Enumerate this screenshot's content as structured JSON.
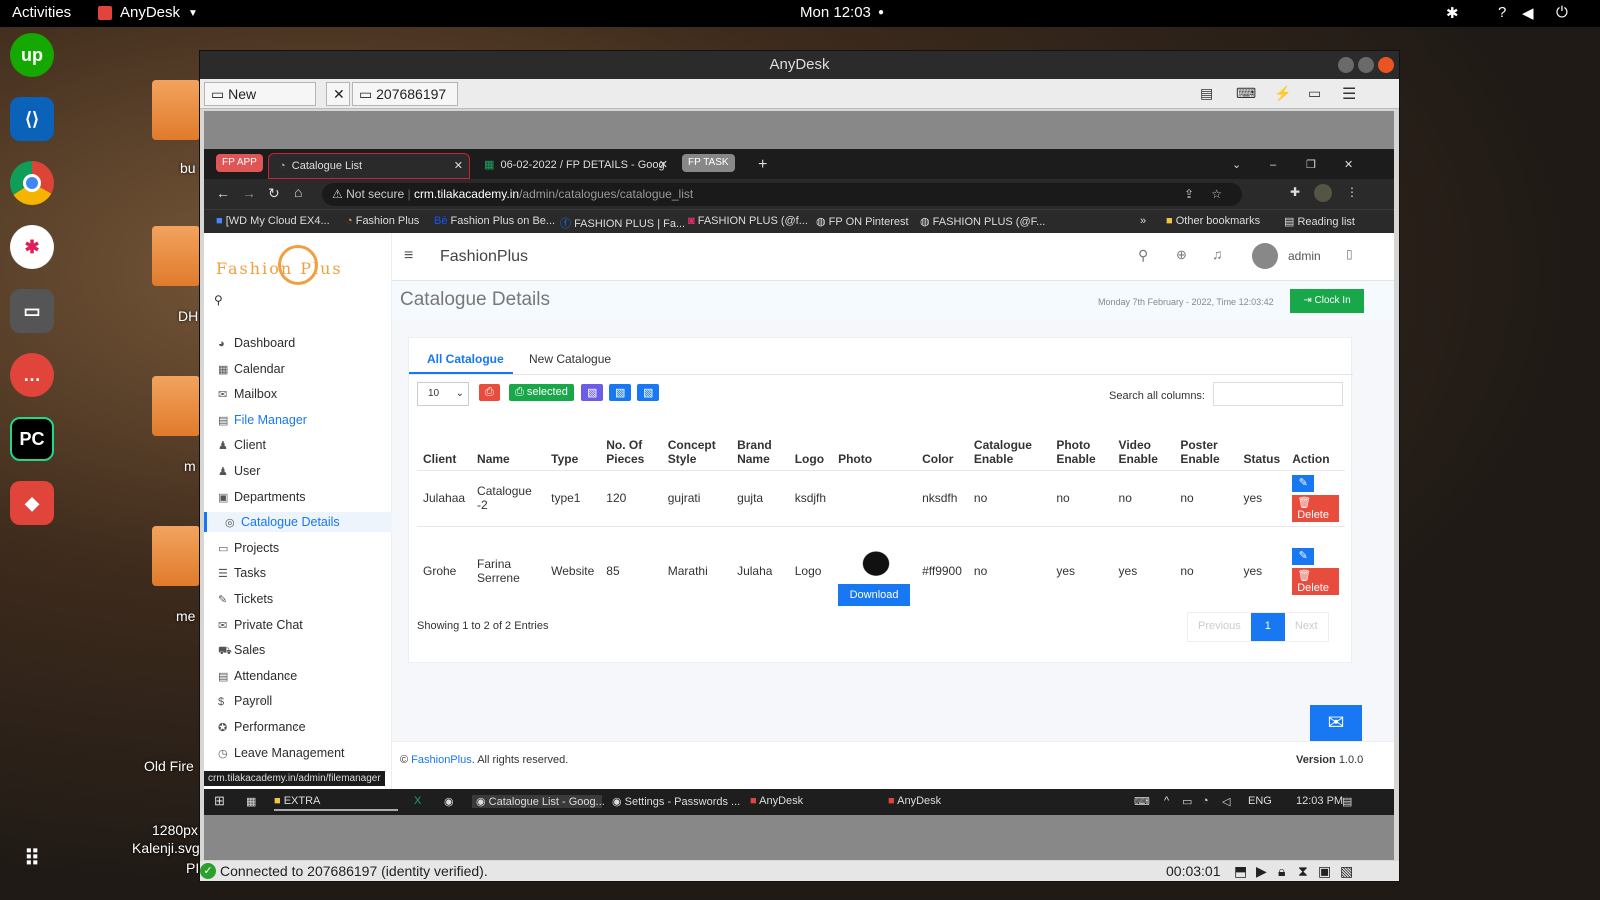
{
  "gnome": {
    "activities": "Activities",
    "app_menu": "AnyDesk",
    "clock": "Mon 12:03"
  },
  "desktop": {
    "labels": [
      "bu",
      "DH",
      "m",
      "me",
      "Old Fire",
      "1280px",
      "Kalenji.svg",
      "PI"
    ]
  },
  "anydesk": {
    "title": "AnyDesk",
    "new_session": "New Session",
    "session_id": "207686197",
    "status": "Connected to 207686197 (identity verified).",
    "timer": "00:03:01"
  },
  "chrome": {
    "tabs": [
      {
        "label": "FP APP"
      },
      {
        "label": "Catalogue List"
      },
      {
        "label": "06-02-2022 / FP DETAILS - Goog"
      },
      {
        "label": "FP TASK"
      }
    ],
    "not_secure": "Not secure",
    "url_domain": "crm.tilakacademy.in",
    "url_path": "/admin/catalogues/catalogue_list",
    "bookmarks": [
      "[WD My Cloud EX4...",
      "Fashion Plus",
      "Fashion Plus on Be...",
      "FASHION PLUS | Fa...",
      "FASHION PLUS (@f...",
      "FP ON Pinterest",
      "FASHION PLUS (@F..."
    ],
    "other_bookmarks": "Other bookmarks",
    "reading_list": "Reading list",
    "status_url": "crm.tilakacademy.in/admin/filemanager"
  },
  "app": {
    "logo_text": "Fashion Plus",
    "brand": "FashionPlus",
    "user": "admin",
    "page_title": "Catalogue Details",
    "datetime": "Monday 7th February - 2022, Time 12:03:42",
    "clock_in": "Clock In",
    "sidebar": [
      {
        "label": "Dashboard",
        "icon": "dashboard-icon",
        "glyph": "◕"
      },
      {
        "label": "Calendar",
        "icon": "calendar-icon",
        "glyph": "▦"
      },
      {
        "label": "Mailbox",
        "icon": "mail-icon",
        "glyph": "✉"
      },
      {
        "label": "File Manager",
        "icon": "file-icon",
        "glyph": "▤"
      },
      {
        "label": "Client",
        "icon": "users-icon",
        "glyph": "♟"
      },
      {
        "label": "User",
        "icon": "user-icon",
        "glyph": "♟"
      },
      {
        "label": "Departments",
        "icon": "lock-icon",
        "glyph": "▣"
      },
      {
        "label": "Catalogue Details",
        "icon": "circle-icon",
        "glyph": "◎"
      },
      {
        "label": "Projects",
        "icon": "folder-icon",
        "glyph": "▭"
      },
      {
        "label": "Tasks",
        "icon": "tasks-icon",
        "glyph": "☰"
      },
      {
        "label": "Tickets",
        "icon": "ticket-icon",
        "glyph": "✎"
      },
      {
        "label": "Private Chat",
        "icon": "chat-icon",
        "glyph": "✉"
      },
      {
        "label": "Sales",
        "icon": "cart-icon",
        "glyph": "⛟"
      },
      {
        "label": "Attendance",
        "icon": "attendance-icon",
        "glyph": "▤"
      },
      {
        "label": "Payroll",
        "icon": "dollar-icon",
        "glyph": "$"
      },
      {
        "label": "Performance",
        "icon": "performance-icon",
        "glyph": "✪"
      },
      {
        "label": "Leave Management",
        "icon": "leave-icon",
        "glyph": "◷"
      }
    ],
    "tabs": {
      "all": "All Catalogue",
      "new": "New Catalogue"
    },
    "page_size": "10",
    "selected_btn": "selected",
    "search_label": "Search all columns:",
    "columns": [
      "Client",
      "Name",
      "Type",
      "No. Of Pieces",
      "Concept Style",
      "Brand Name",
      "Logo",
      "Photo",
      "Color",
      "Catalogue Enable",
      "Photo Enable",
      "Video Enable",
      "Poster Enable",
      "Status",
      "Action"
    ],
    "rows": [
      {
        "client": "Julahaa",
        "name": "Catalogue -2",
        "type": "type1",
        "pieces": "120",
        "concept": "gujrati",
        "brand": "gujta",
        "logo": "ksdjfh",
        "color": "nksdfh",
        "cat_enable": "no",
        "photo_enable": "no",
        "video_enable": "no",
        "poster_enable": "no",
        "status": "yes"
      },
      {
        "client": "Grohe",
        "name": "Farina Serrene",
        "type": "Website",
        "pieces": "85",
        "concept": "Marathi",
        "brand": "Julaha",
        "logo": "Logo",
        "color": "#ff9900",
        "cat_enable": "no",
        "photo_enable": "yes",
        "video_enable": "yes",
        "poster_enable": "no",
        "status": "yes"
      }
    ],
    "delete_label": "Delete",
    "download_label": "Download",
    "showing": "Showing 1 to 2 of 2 Entries",
    "pagination": {
      "prev": "Previous",
      "page": "1",
      "next": "Next"
    },
    "footer_brand": "FashionPlus",
    "footer_rest": ". All rights reserved.",
    "version_label": "Version",
    "version": "1.0.0"
  },
  "windows_taskbar": {
    "items": [
      "EXTRA",
      "Catalogue List - Goog...",
      "Settings - Passwords ...",
      "AnyDesk",
      "AnyDesk"
    ],
    "lang": "ENG",
    "time": "12:03 PM"
  }
}
